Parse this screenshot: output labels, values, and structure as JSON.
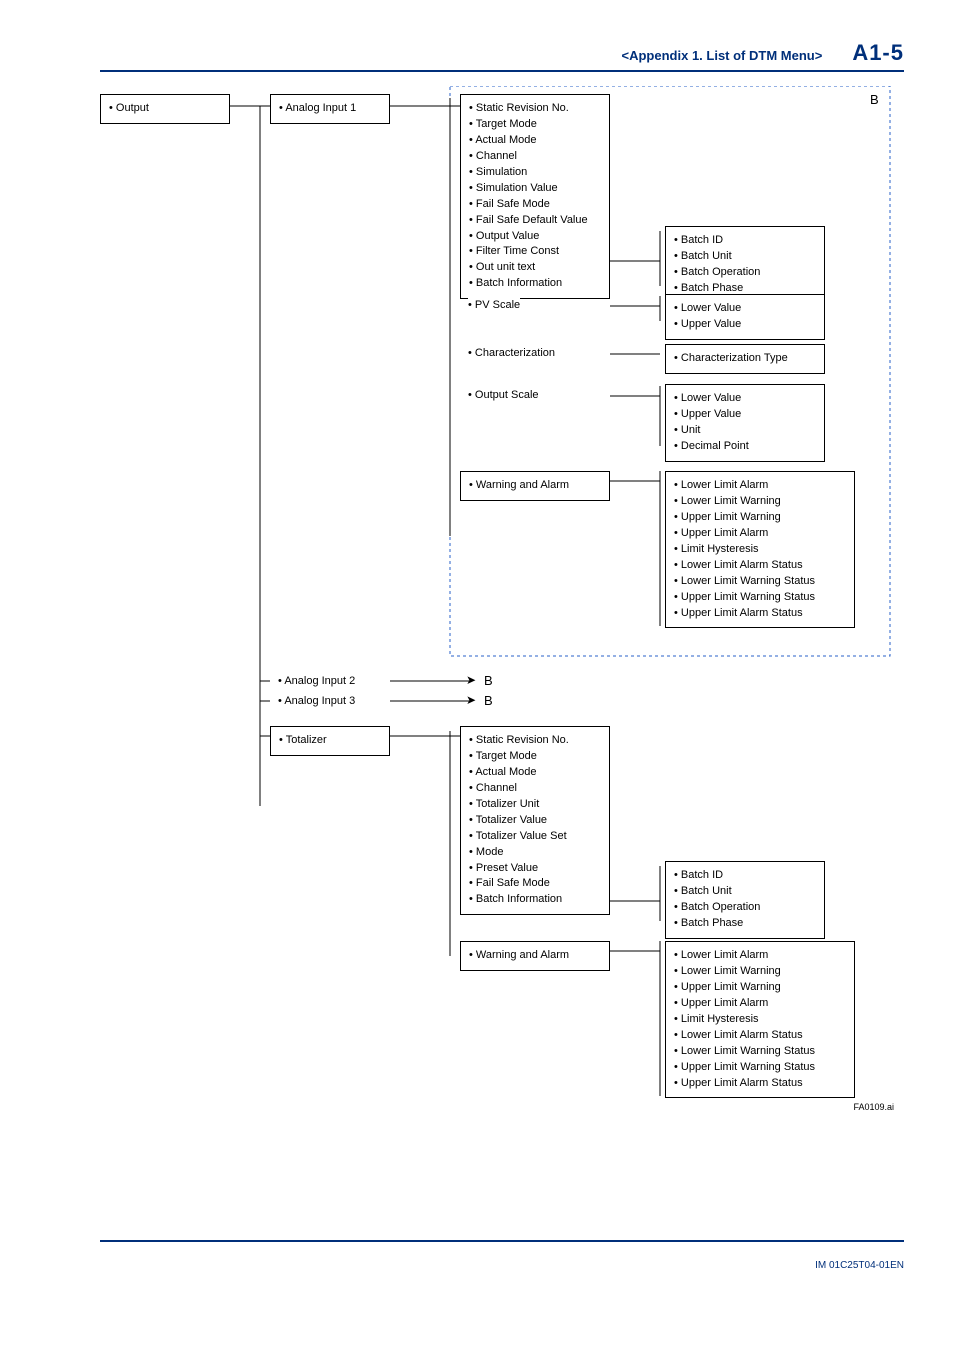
{
  "header": {
    "section": "<Appendix 1.  List of DTM Menu>",
    "pageno": "A1-5"
  },
  "root": {
    "output": "Output"
  },
  "col2": {
    "ai1": "Analog Input 1",
    "ai2": "Analog Input 2",
    "ai3": "Analog Input 3",
    "tot": "Totalizer"
  },
  "ai_detail": {
    "static": "Static Revision No.",
    "target": "Target Mode",
    "actual": "Actual Mode",
    "channel": "Channel",
    "sim": "Simulation",
    "simval": "Simulation Value",
    "fsm": "Fail Safe Mode",
    "fsdef": "Fail Safe Default Value",
    "outv": "Output Value",
    "filt": "Filter Time Const",
    "outunit": "Out unit text",
    "batchinfo": "Batch Information",
    "pvscale": "PV Scale",
    "chartn": "Characterization",
    "outscale": "Output Scale",
    "warn": "Warning and Alarm"
  },
  "batch": {
    "id": "Batch ID",
    "unit": "Batch Unit",
    "op": "Batch Operation",
    "phase": "Batch Phase"
  },
  "pv": {
    "low": "Lower Value",
    "up": "Upper Value"
  },
  "chartype": {
    "ct": "Characterization Type"
  },
  "outsc": {
    "low": "Lower Value",
    "up": "Upper Value",
    "unit": "Unit",
    "dp": "Decimal Point"
  },
  "alarm": {
    "lla": "Lower Limit Alarm",
    "llw": "Lower Limit Warning",
    "ulw": "Upper Limit Warning",
    "ula": "Upper Limit Alarm",
    "hyst": "Limit Hysteresis",
    "llas": "Lower Limit Alarm Status",
    "llws": "Lower Limit Warning Status",
    "ulws": "Upper Limit Warning Status",
    "ulas": "Upper Limit Alarm Status"
  },
  "tot_detail": {
    "static": "Static Revision No.",
    "target": "Target Mode",
    "actual": "Actual Mode",
    "channel": "Channel",
    "tunit": "Totalizer Unit",
    "tval": "Totalizer Value",
    "tvset": "Totalizer Value Set",
    "mode": "Mode",
    "preset": "Preset Value",
    "fsm": "Fail Safe Mode",
    "batchinfo": "Batch Information",
    "warn": "Warning and Alarm"
  },
  "ref": {
    "b": "B"
  },
  "figid": "FA0109.ai",
  "docid": "IM 01C25T04-01EN"
}
